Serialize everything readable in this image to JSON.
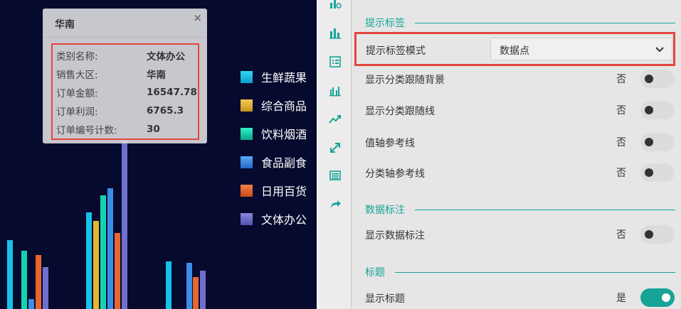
{
  "chart": {
    "legend": [
      {
        "label": "生鲜蔬果",
        "color": "#16c2e8"
      },
      {
        "label": "综合商品",
        "color": "#e6b62f"
      },
      {
        "label": "饮料烟酒",
        "color": "#14d4b0"
      },
      {
        "label": "食品副食",
        "color": "#3a8ee8"
      },
      {
        "label": "日用百货",
        "color": "#e9652e"
      },
      {
        "label": "文体办公",
        "color": "#6f6fcc"
      }
    ],
    "tooltip": {
      "title": "华南",
      "close": "×",
      "rows": [
        {
          "label": "类别名称:",
          "value": "文体办公"
        },
        {
          "label": "销售大区:",
          "value": "华南"
        },
        {
          "label": "订单金额:",
          "value": "16547.78"
        },
        {
          "label": "订单利润:",
          "value": "6765.3"
        },
        {
          "label": "订单编号计数:",
          "value": "30"
        }
      ]
    }
  },
  "sidebar": {
    "icons": [
      "bar-chart-settings-icon",
      "column-chart-icon",
      "form-icon",
      "grouped-bar-icon",
      "trend-line-icon",
      "expand-icon",
      "list-icon",
      "share-icon"
    ]
  },
  "settings": {
    "sections": {
      "tooltip": "提示标签",
      "data_labels": "数据标注",
      "title": "标题"
    },
    "tooltip_mode": {
      "label": "提示标签模式",
      "value": "数据点"
    },
    "rows": [
      {
        "label": "显示分类跟随背景",
        "value": "否",
        "on": false
      },
      {
        "label": "显示分类跟随线",
        "value": "否",
        "on": false
      },
      {
        "label": "值轴参考线",
        "value": "否",
        "on": false
      },
      {
        "label": "分类轴参考线",
        "value": "否",
        "on": false
      }
    ],
    "data_label_row": {
      "label": "显示数据标注",
      "value": "否",
      "on": false
    },
    "title_row": {
      "label": "显示标题",
      "value": "是",
      "on": true
    }
  }
}
